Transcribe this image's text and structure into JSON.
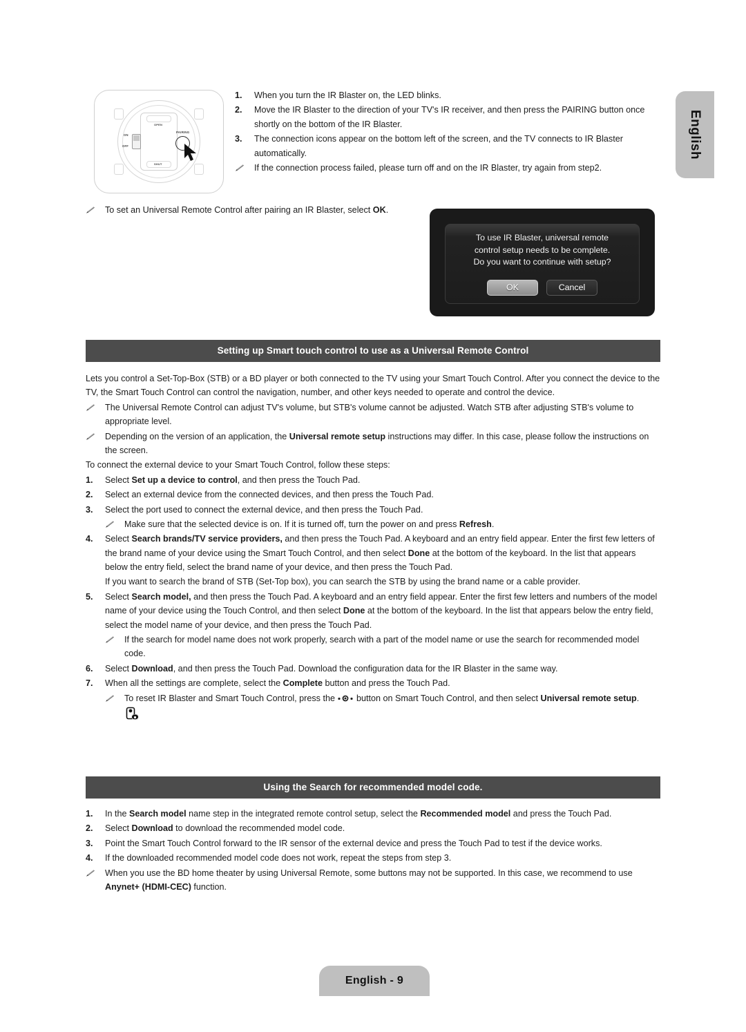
{
  "language_tab": {
    "label": "English"
  },
  "footer": {
    "label": "English - 9"
  },
  "figure": {
    "name": "ir-blaster-bottom-view",
    "labels": {
      "on": "ON",
      "off": "OFF",
      "open": "OPEN",
      "shut": "SHUT",
      "pairing": "PAIRING"
    }
  },
  "pairing_steps": [
    {
      "marker": "1.",
      "text": "When you turn the IR Blaster on, the LED blinks."
    },
    {
      "marker": "2.",
      "text": "Move the IR Blaster to the direction of your TV's IR receiver, and then press the PAIRING button once shortly on the bottom of the IR Blaster."
    },
    {
      "marker": "3.",
      "text": "The connection icons appear on the bottom left of the screen, and the TV connects to IR Blaster automatically."
    }
  ],
  "pairing_note": "If the connection process failed, please turn off and on the IR Blaster, try again from step2.",
  "ok_note_prefix": "To set an Universal Remote Control after pairing an IR Blaster, select ",
  "ok_note_bold": "OK",
  "ok_note_suffix": ".",
  "dialog": {
    "message_line1": "To use IR Blaster, universal remote",
    "message_line2": "control setup needs to be complete.",
    "message_line3": "Do you want to continue with setup?",
    "ok_label": "OK",
    "cancel_label": "Cancel"
  },
  "section1": {
    "heading": "Setting up Smart touch control to use as a Universal Remote Control",
    "intro": "Lets you control a Set-Top-Box (STB) or a BD player or both connected to the TV using your Smart Touch Control. After you connect the device to the TV, the Smart Touch Control can control the navigation, number, and other keys needed to operate and control the device.",
    "note1": "The Universal Remote Control can adjust TV's volume, but STB's volume cannot be adjusted. Watch STB after adjusting STB's volume to appropriate level.",
    "note2_part1": "Depending on the version of an application, the ",
    "note2_bold": "Universal remote setup",
    "note2_part2": " instructions may differ. In this case, please follow the instructions on the screen.",
    "lead": "To connect the external device to your Smart Touch Control, follow these steps:",
    "step1_pre": "Select ",
    "step1_bold": "Set up a device to control",
    "step1_post": ", and then press the Touch Pad.",
    "step2": "Select an external device from the connected devices, and then press the Touch Pad.",
    "step3": "Select the port used to connect the external device, and then press the Touch Pad.",
    "step3_note_pre": "Make sure that the selected device is on. If it is turned off, turn the power on and press ",
    "step3_note_bold": "Refresh",
    "step3_note_post": ".",
    "step4_pre": "Select ",
    "step4_bold": "Search brands/TV service providers,",
    "step4_mid": " and then press the Touch Pad. A keyboard and an entry field appear. Enter the first few letters of the brand name of your device using the Smart Touch Control, and then select ",
    "step4_bold2": "Done",
    "step4_post": " at the bottom of the keyboard. In the list that appears below the entry field, select the brand name of your device, and then press the Touch Pad.",
    "step4_extra": "If you want to search the brand of STB (Set-Top box), you can search the STB by using the brand name or a cable provider.",
    "step5_pre": "Select ",
    "step5_bold": "Search model,",
    "step5_mid": " and then press the Touch Pad. A keyboard and an entry field appear. Enter the first few letters and numbers of the model name of your device using the Touch Control, and then select ",
    "step5_bold2": "Done",
    "step5_post": " at the bottom of the keyboard. In the list that appears below the entry field, select the model name of your device, and then press the Touch Pad.",
    "step5_note": "If the search for model name does not work properly, search with a part of the model name or use the search for recommended model code.",
    "step6_pre": "Select ",
    "step6_bold": "Download",
    "step6_post": ", and then press the Touch Pad. Download the configuration data for the IR Blaster in the same way.",
    "step7_pre": "When all the settings are complete, select the ",
    "step7_bold": "Complete",
    "step7_post": " button and press the Touch Pad.",
    "step7_note_pre": "To reset IR Blaster and Smart Touch Control, press the ",
    "step7_note_mid": " button on Smart Touch Control, and then select ",
    "step7_note_bold": "Universal remote setup",
    "step7_note_post": "."
  },
  "section2": {
    "heading": "Using the Search for recommended model code.",
    "step1_pre": "In the ",
    "step1_bold": "Search model",
    "step1_mid": " name step in the integrated remote control setup, select the ",
    "step1_bold2": "Recommended model",
    "step1_post": " and press the Touch Pad.",
    "step2_pre": "Select ",
    "step2_bold": "Download",
    "step2_post": " to download the recommended model code.",
    "step3": "Point the Smart Touch Control forward to the IR sensor of the external device and press the Touch Pad to test if the device works.",
    "step4": "If the downloaded recommended model code does not work, repeat the steps from step 3.",
    "note_pre": "When you use the BD home theater by using Universal Remote, some buttons may not be supported. In this case, we recommend to use ",
    "note_bold": "Anynet+ (HDMI-CEC)",
    "note_post": " function."
  },
  "markers": {
    "m1": "1.",
    "m2": "2.",
    "m3": "3.",
    "m4": "4.",
    "m5": "5.",
    "m6": "6.",
    "m7": "7."
  },
  "colors": {
    "heading_bar": "#4c4c4c",
    "tab_gray": "#bfbfbf",
    "dialog_bg": "#1a1a1a",
    "text": "#1c1c1c"
  }
}
